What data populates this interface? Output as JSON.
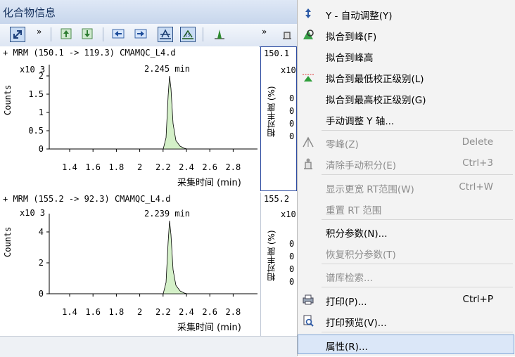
{
  "window": {
    "title": "化合物信息"
  },
  "toolbar": {
    "overflow": "»"
  },
  "panels": [
    {
      "header": "+ MRM (150.1 -> 119.3) CMAMQC_L4.d",
      "ylabel": "Counts",
      "yexp": "x10 3",
      "peak_label": "2.245 min",
      "yticks": [
        "2",
        "1.5",
        "1",
        "0.5",
        "0"
      ],
      "xticks": [
        "1.4",
        "1.6",
        "1.8",
        "2",
        "2.2",
        "2.4",
        "2.6",
        "2.8"
      ],
      "xlabel": "采集时间 (min)"
    },
    {
      "header": "+ MRM (155.2 -> 92.3) CMAMQC_L4.d",
      "ylabel": "Counts",
      "yexp": "x10 3",
      "peak_label": "2.239 min",
      "yticks": [
        "4",
        "2",
        "0"
      ],
      "xticks": [
        "1.4",
        "1.6",
        "1.8",
        "2",
        "2.2",
        "2.4",
        "2.6",
        "2.8"
      ],
      "xlabel": "采集时间 (min)"
    }
  ],
  "side_panels": [
    {
      "header": "150.1",
      "ylabel": "相对丰度 (%)",
      "yexp": "x10",
      "ticks": [
        "0",
        "0",
        "0",
        "0"
      ]
    },
    {
      "header": "155.2",
      "ylabel": "相对丰度 (%)",
      "yexp": "x10",
      "ticks": [
        "0",
        "0",
        "0",
        "0"
      ]
    }
  ],
  "menu": {
    "items": [
      {
        "label": "Y - 自动调整(Y)",
        "shortcut": "",
        "icon": "y-autoscale-icon",
        "disabled": false
      },
      {
        "label": "拟合到峰(F)",
        "shortcut": "",
        "icon": "fit-to-peak-icon",
        "disabled": false
      },
      {
        "label": "拟合到峰高",
        "shortcut": "",
        "icon": "",
        "disabled": false
      },
      {
        "label": "拟合到最低校正级别(L)",
        "shortcut": "",
        "icon": "fit-lowest-cal-icon",
        "disabled": false
      },
      {
        "label": "拟合到最高校正级别(G)",
        "shortcut": "",
        "icon": "",
        "disabled": false
      },
      {
        "label": "手动调整 Y 轴...",
        "shortcut": "",
        "icon": "",
        "disabled": false
      },
      {
        "label": "零峰(Z)",
        "shortcut": "Delete",
        "icon": "zero-peak-icon",
        "disabled": true
      },
      {
        "label": "清除手动积分(E)",
        "shortcut": "Ctrl+3",
        "icon": "clear-manual-integration-icon",
        "disabled": true
      },
      {
        "label": "显示更宽 RT范围(W)",
        "shortcut": "Ctrl+W",
        "icon": "",
        "disabled": true
      },
      {
        "label": "重置 RT 范围",
        "shortcut": "",
        "icon": "",
        "disabled": true
      },
      {
        "label": "积分参数(N)...",
        "shortcut": "",
        "icon": "",
        "disabled": false
      },
      {
        "label": "恢复积分参数(T)",
        "shortcut": "",
        "icon": "",
        "disabled": true
      },
      {
        "label": "谱库检索...",
        "shortcut": "",
        "icon": "",
        "disabled": true
      },
      {
        "label": "打印(P)...",
        "shortcut": "Ctrl+P",
        "icon": "printer-icon",
        "disabled": false
      },
      {
        "label": "打印预览(V)...",
        "shortcut": "",
        "icon": "print-preview-icon",
        "disabled": false
      },
      {
        "label": "属性(R)...",
        "shortcut": "",
        "icon": "",
        "disabled": false
      }
    ]
  },
  "colors": {
    "peak_fill": "#d4f0c8",
    "accent": "#2a4f86",
    "highlight": "#dbe7f8"
  }
}
